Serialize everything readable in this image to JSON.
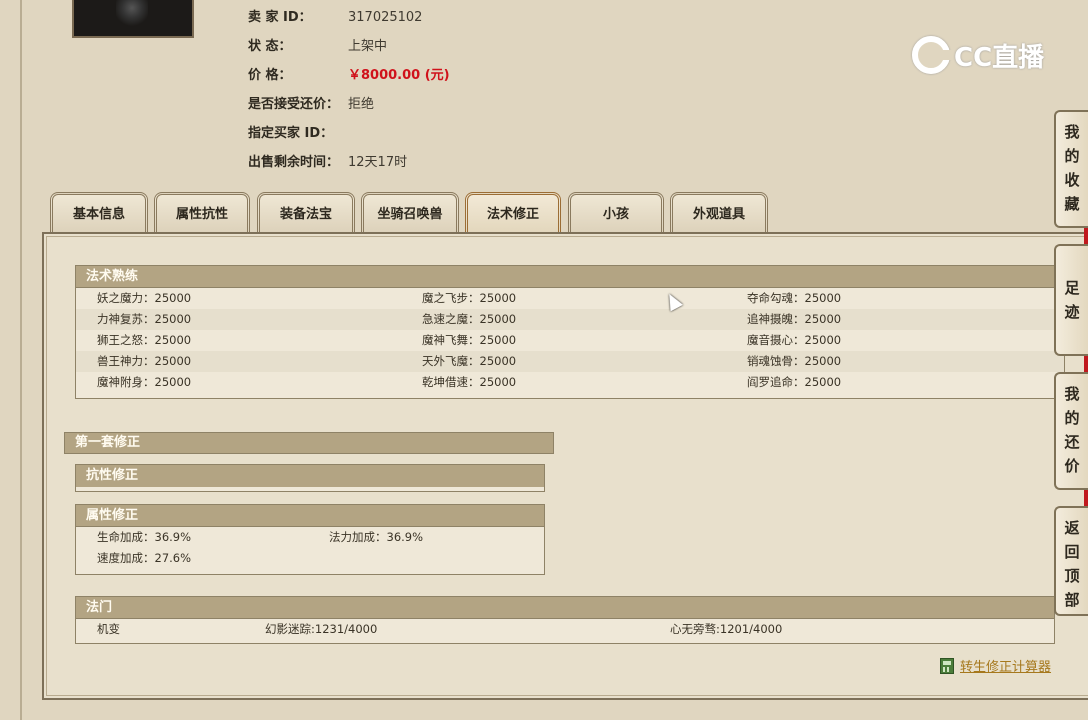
{
  "seller_info": {
    "rows": [
      {
        "key": "卖    家    ID：",
        "value": "317025102"
      },
      {
        "key": "状          态：",
        "value": "上架中"
      },
      {
        "key": "价          格：",
        "value": "￥8000.00 (元)"
      },
      {
        "key": "是否接受还价：",
        "value": "拒绝"
      },
      {
        "key": "指定买家 ID：",
        "value": ""
      },
      {
        "key": "出售剩余时间：",
        "value": "12天17时"
      }
    ]
  },
  "logo": {
    "text": "CC直播"
  },
  "tabs": [
    {
      "label": "基本信息"
    },
    {
      "label": "属性抗性"
    },
    {
      "label": "装备法宝"
    },
    {
      "label": "坐骑召唤兽"
    },
    {
      "label": "法术修正"
    },
    {
      "label": "小孩"
    },
    {
      "label": "外观道具"
    }
  ],
  "active_tab": "法术修正",
  "spell_proficiency": {
    "title": "法术熟练",
    "rows": [
      [
        "妖之魔力：25000",
        "魔之飞步：25000",
        "夺命勾魂：25000"
      ],
      [
        "力神复苏：25000",
        "急速之魔：25000",
        "追神摄魄：25000"
      ],
      [
        "狮王之怒：25000",
        "魔神飞舞：25000",
        "魔音摄心：25000"
      ],
      [
        "兽王神力：25000",
        "天外飞魔：25000",
        "销魂蚀骨：25000"
      ],
      [
        "魔神附身：25000",
        "乾坤借速：25000",
        "阎罗追命：25000"
      ]
    ]
  },
  "first_set": {
    "title": "第一套修正"
  },
  "resist_mod": {
    "title": "抗性修正"
  },
  "attr_mod": {
    "title": "属性修正",
    "rows": [
      [
        "生命加成：36.9%",
        "法力加成：36.9%"
      ],
      [
        "速度加成：27.6%",
        ""
      ]
    ]
  },
  "sect": {
    "title": "法门",
    "row": [
      "机变",
      "幻影迷踪:1231/4000",
      "心无旁骛:1201/4000"
    ]
  },
  "side_tabs": [
    {
      "label": "我的收藏"
    },
    {
      "label": "足迹"
    },
    {
      "label": "我的还价"
    },
    {
      "label": "返回顶部"
    }
  ],
  "calculator_link": "转生修正计算器"
}
